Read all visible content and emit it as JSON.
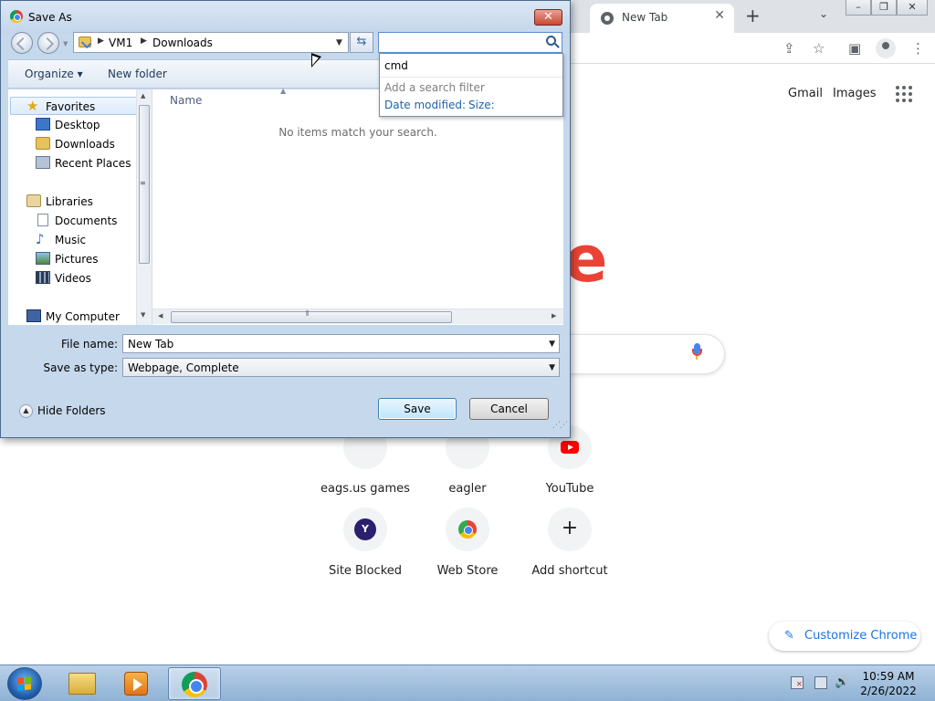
{
  "chrome": {
    "tab_title": "New Tab",
    "header_links": [
      "Gmail",
      "Images"
    ],
    "logo_fragment": "e",
    "shortcuts": [
      {
        "label": "eags.us games",
        "icon": "blank-site-icon"
      },
      {
        "label": "eagler",
        "icon": "blank-site-icon"
      },
      {
        "label": "YouTube",
        "icon": "youtube-icon"
      },
      {
        "label": "Site Blocked",
        "icon": "y-letter-icon",
        "icon_text": "Y"
      },
      {
        "label": "Web Store",
        "icon": "web-store-icon"
      },
      {
        "label": "Add shortcut",
        "icon": "plus-icon",
        "icon_text": "+"
      }
    ],
    "customize_label": "Customize Chrome",
    "accent_color": "#1a73e8"
  },
  "dialog": {
    "title": "Save As",
    "breadcrumb": [
      "VM1",
      "Downloads"
    ],
    "search_value": "",
    "search_dropdown": {
      "history_item": "cmd",
      "hint": "Add a search filter",
      "filters": [
        "Date modified:",
        "Size:"
      ]
    },
    "toolbar": {
      "organize_label": "Organize",
      "new_folder_label": "New folder"
    },
    "nav": {
      "favorites": {
        "label": "Favorites",
        "items": [
          "Desktop",
          "Downloads",
          "Recent Places"
        ]
      },
      "libraries": {
        "label": "Libraries",
        "items": [
          "Documents",
          "Music",
          "Pictures",
          "Videos"
        ]
      },
      "computer": {
        "label": "My Computer"
      }
    },
    "file_list": {
      "column_name": "Name",
      "empty_message": "No items match your search."
    },
    "file_name": {
      "label": "File name:",
      "value": "New Tab"
    },
    "save_type": {
      "label": "Save as type:",
      "value": "Webpage, Complete"
    },
    "hide_folders_label": "Hide Folders",
    "save_label": "Save",
    "cancel_label": "Cancel"
  },
  "taskbar": {
    "apps": [
      "explorer-icon",
      "media-player-icon",
      "chrome-icon"
    ],
    "active_app": "chrome-icon",
    "time": "10:59 AM",
    "date": "2/26/2022"
  }
}
